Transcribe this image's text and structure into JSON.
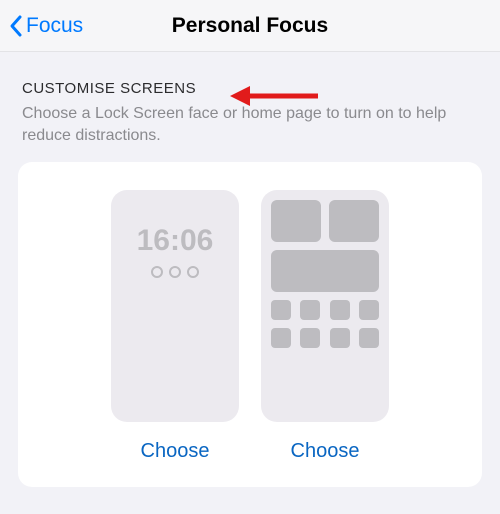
{
  "nav": {
    "back_label": "Focus",
    "title": "Personal Focus"
  },
  "section": {
    "header": "CUSTOMISE SCREENS",
    "description": "Choose a Lock Screen face or home page to turn on to help reduce distractions."
  },
  "lock_preview": {
    "time": "16:06"
  },
  "actions": {
    "choose_lock": "Choose",
    "choose_home": "Choose"
  },
  "colors": {
    "accent": "#007aff",
    "link": "#0a66c2",
    "arrow": "#e11b1b"
  }
}
